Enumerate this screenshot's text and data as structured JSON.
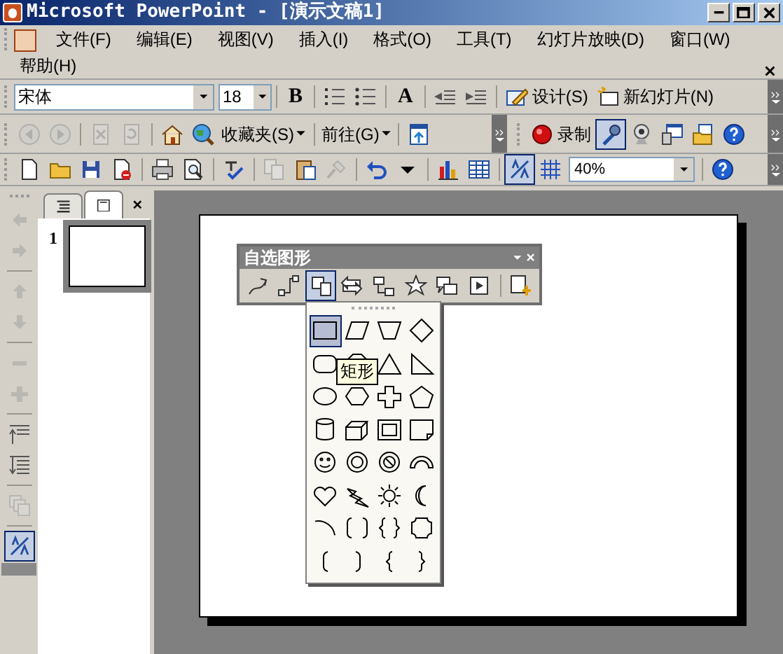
{
  "window": {
    "title": "Microsoft PowerPoint - [演示文稿1]"
  },
  "menu": [
    "文件(F)",
    "编辑(E)",
    "视图(V)",
    "插入(I)",
    "格式(O)",
    "工具(T)",
    "幻灯片放映(D)",
    "窗口(W)",
    "帮助(H)"
  ],
  "formatting": {
    "font": "宋体",
    "size": "18",
    "items": [
      {
        "kind": "text",
        "label": "B",
        "disabled": false,
        "pressed": false
      },
      {
        "kind": "sep"
      },
      {
        "kind": "icon",
        "disabled": false,
        "pressed": false
      },
      {
        "kind": "icon",
        "disabled": false,
        "pressed": false
      },
      {
        "kind": "sep"
      },
      {
        "kind": "text",
        "label": "A",
        "disabled": false,
        "pressed": false
      },
      {
        "kind": "sep"
      },
      {
        "kind": "icon",
        "disabled": false,
        "pressed": false
      },
      {
        "kind": "icon",
        "disabled": false,
        "pressed": false
      },
      {
        "kind": "sep"
      },
      {
        "kind": "labeled",
        "label": "设计(S)",
        "disabled": false,
        "pressed": false
      },
      {
        "kind": "labeled",
        "label": "新幻灯片(N)",
        "disabled": false,
        "pressed": false
      }
    ]
  },
  "web": {
    "items": [
      {
        "kind": "icon",
        "disabled": true,
        "pressed": false
      },
      {
        "kind": "icon",
        "disabled": true,
        "pressed": false
      },
      {
        "kind": "sep"
      },
      {
        "kind": "icon",
        "disabled": true,
        "pressed": false
      },
      {
        "kind": "icon",
        "disabled": true,
        "pressed": false
      },
      {
        "kind": "sep"
      },
      {
        "kind": "icon",
        "disabled": false,
        "pressed": false
      },
      {
        "kind": "icon",
        "disabled": false,
        "pressed": false
      },
      {
        "kind": "menu",
        "label": "收藏夹(S)"
      },
      {
        "kind": "sep"
      },
      {
        "kind": "menu",
        "label": "前往(G)"
      },
      {
        "kind": "sep"
      },
      {
        "kind": "icon",
        "disabled": false,
        "pressed": false
      }
    ]
  },
  "recording": {
    "items": [
      {
        "kind": "labeled",
        "label": "录制",
        "disabled": false,
        "pressed": false
      },
      {
        "kind": "icon",
        "disabled": false,
        "pressed": true
      },
      {
        "kind": "icon",
        "disabled": false,
        "pressed": false
      },
      {
        "kind": "icon",
        "disabled": false,
        "pressed": false
      },
      {
        "kind": "icon",
        "disabled": false,
        "pressed": false
      },
      {
        "kind": "icon",
        "disabled": false,
        "pressed": false
      }
    ]
  },
  "standard": {
    "zoom": "40%",
    "items": [
      {
        "kind": "icon",
        "disabled": false,
        "pressed": false
      },
      {
        "kind": "icon",
        "disabled": false,
        "pressed": false
      },
      {
        "kind": "icon",
        "disabled": false,
        "pressed": false
      },
      {
        "kind": "icon",
        "disabled": false,
        "pressed": false
      },
      {
        "kind": "sep"
      },
      {
        "kind": "icon",
        "disabled": false,
        "pressed": false
      },
      {
        "kind": "icon",
        "disabled": false,
        "pressed": false
      },
      {
        "kind": "sep"
      },
      {
        "kind": "icon",
        "disabled": false,
        "pressed": false
      },
      {
        "kind": "sep"
      },
      {
        "kind": "icon",
        "disabled": true,
        "pressed": false
      },
      {
        "kind": "icon",
        "disabled": false,
        "pressed": false
      },
      {
        "kind": "icon",
        "disabled": true,
        "pressed": false
      },
      {
        "kind": "sep"
      },
      {
        "kind": "icon",
        "disabled": false,
        "pressed": false
      },
      {
        "kind": "icon",
        "disabled": false,
        "pressed": false
      },
      {
        "kind": "sep"
      },
      {
        "kind": "icon",
        "disabled": false,
        "pressed": false
      },
      {
        "kind": "icon",
        "disabled": false,
        "pressed": false
      },
      {
        "kind": "sep"
      },
      {
        "kind": "icon",
        "disabled": false,
        "pressed": true
      },
      {
        "kind": "icon",
        "disabled": false,
        "pressed": false
      },
      {
        "kind": "zoom"
      },
      {
        "kind": "sep"
      },
      {
        "kind": "icon",
        "disabled": false,
        "pressed": false
      }
    ]
  },
  "outlining": {
    "items": [
      {
        "kind": "icon",
        "disabled": true,
        "pressed": false
      },
      {
        "kind": "icon",
        "disabled": true,
        "pressed": false
      },
      {
        "kind": "sep"
      },
      {
        "kind": "icon",
        "disabled": true,
        "pressed": false
      },
      {
        "kind": "icon",
        "disabled": true,
        "pressed": false
      },
      {
        "kind": "sep"
      },
      {
        "kind": "icon",
        "disabled": true,
        "pressed": false
      },
      {
        "kind": "icon",
        "disabled": true,
        "pressed": false
      },
      {
        "kind": "sep"
      },
      {
        "kind": "icon",
        "disabled": false,
        "pressed": false
      },
      {
        "kind": "icon",
        "disabled": false,
        "pressed": false
      },
      {
        "kind": "sep"
      },
      {
        "kind": "icon",
        "disabled": true,
        "pressed": false
      },
      {
        "kind": "sep"
      },
      {
        "kind": "icon",
        "disabled": false,
        "pressed": true
      }
    ]
  },
  "pane": {
    "tabs": [
      {
        "selected": false
      },
      {
        "selected": true
      }
    ],
    "slides": [
      {
        "number": "1",
        "selected": true
      }
    ]
  },
  "autoshapes": {
    "title": "自选图形",
    "tools": [
      {
        "pressed": false
      },
      {
        "pressed": false
      },
      {
        "pressed": true
      },
      {
        "pressed": false
      },
      {
        "pressed": false
      },
      {
        "pressed": false
      },
      {
        "pressed": false
      },
      {
        "pressed": false
      },
      {
        "pressed": false
      }
    ],
    "shapes": [
      {
        "selected": true
      },
      {
        "selected": false
      },
      {
        "selected": false
      },
      {
        "selected": false
      },
      {
        "selected": false
      },
      {
        "selected": false
      },
      {
        "selected": false
      },
      {
        "selected": false
      },
      {
        "selected": false
      },
      {
        "selected": false
      },
      {
        "selected": false
      },
      {
        "selected": false
      },
      {
        "selected": false
      },
      {
        "selected": false
      },
      {
        "selected": false
      },
      {
        "selected": false
      },
      {
        "selected": false
      },
      {
        "selected": false
      },
      {
        "selected": false
      },
      {
        "selected": false
      },
      {
        "selected": false
      },
      {
        "selected": false
      },
      {
        "selected": false
      },
      {
        "selected": false
      },
      {
        "selected": false
      },
      {
        "selected": false
      },
      {
        "selected": false
      },
      {
        "selected": false
      },
      {
        "selected": false
      },
      {
        "selected": false
      },
      {
        "selected": false
      },
      {
        "selected": false
      }
    ],
    "tooltip": "矩形"
  }
}
